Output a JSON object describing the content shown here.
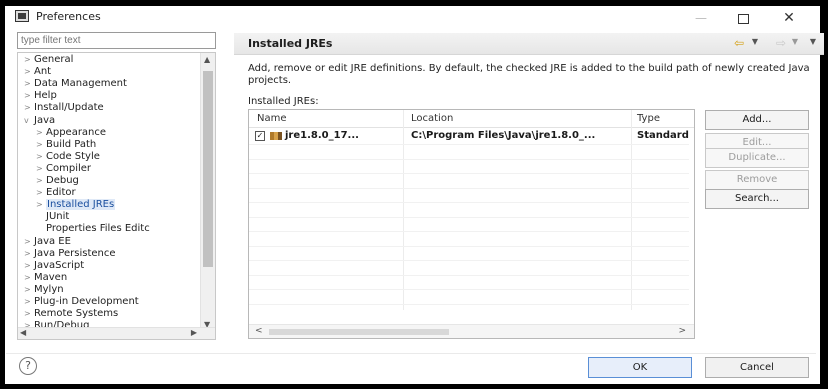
{
  "window": {
    "title": "Preferences",
    "minimize": "—",
    "maximize": "",
    "close": "✕"
  },
  "filter": {
    "placeholder": "type filter text"
  },
  "tree": {
    "items": [
      {
        "label": "General",
        "arrow": ">"
      },
      {
        "label": "Ant",
        "arrow": ">"
      },
      {
        "label": "Data Management",
        "arrow": ">"
      },
      {
        "label": "Help",
        "arrow": ">"
      },
      {
        "label": "Install/Update",
        "arrow": ">"
      },
      {
        "label": "Java",
        "arrow": "v"
      },
      {
        "label": "Appearance",
        "arrow": ">"
      },
      {
        "label": "Build Path",
        "arrow": ">"
      },
      {
        "label": "Code Style",
        "arrow": ">"
      },
      {
        "label": "Compiler",
        "arrow": ">"
      },
      {
        "label": "Debug",
        "arrow": ">"
      },
      {
        "label": "Editor",
        "arrow": ">"
      },
      {
        "label": "Installed JREs",
        "arrow": ">"
      },
      {
        "label": "JUnit",
        "arrow": ""
      },
      {
        "label": "Properties Files Editc",
        "arrow": ""
      },
      {
        "label": "Java EE",
        "arrow": ">"
      },
      {
        "label": "Java Persistence",
        "arrow": ">"
      },
      {
        "label": "JavaScript",
        "arrow": ">"
      },
      {
        "label": "Maven",
        "arrow": ">"
      },
      {
        "label": "Mylyn",
        "arrow": ">"
      },
      {
        "label": "Plug-in Development",
        "arrow": ">"
      },
      {
        "label": "Remote Systems",
        "arrow": ">"
      },
      {
        "label": "Run/Debug",
        "arrow": ">"
      }
    ]
  },
  "page": {
    "title": "Installed JREs",
    "description": "Add, remove or edit JRE definitions. By default, the checked JRE is added to the build path of newly created Java projects.",
    "list_label": "Installed JREs:"
  },
  "table": {
    "headers": {
      "name": "Name",
      "location": "Location",
      "type": "Type"
    },
    "rows": [
      {
        "checked": true,
        "name": "jre1.8.0_17...",
        "location": "C:\\Program Files\\Java\\jre1.8.0_...",
        "type": "Standard"
      }
    ]
  },
  "buttons": {
    "add": "Add...",
    "edit": "Edit...",
    "duplicate": "Duplicate...",
    "remove": "Remove",
    "search": "Search...",
    "ok": "OK",
    "cancel": "Cancel"
  },
  "icons": {
    "help": "?",
    "nav_back": "⇦",
    "nav_forward": "⇨"
  },
  "colors": {
    "accent": "#5a8fd6",
    "selection": "#dfe9f7"
  }
}
